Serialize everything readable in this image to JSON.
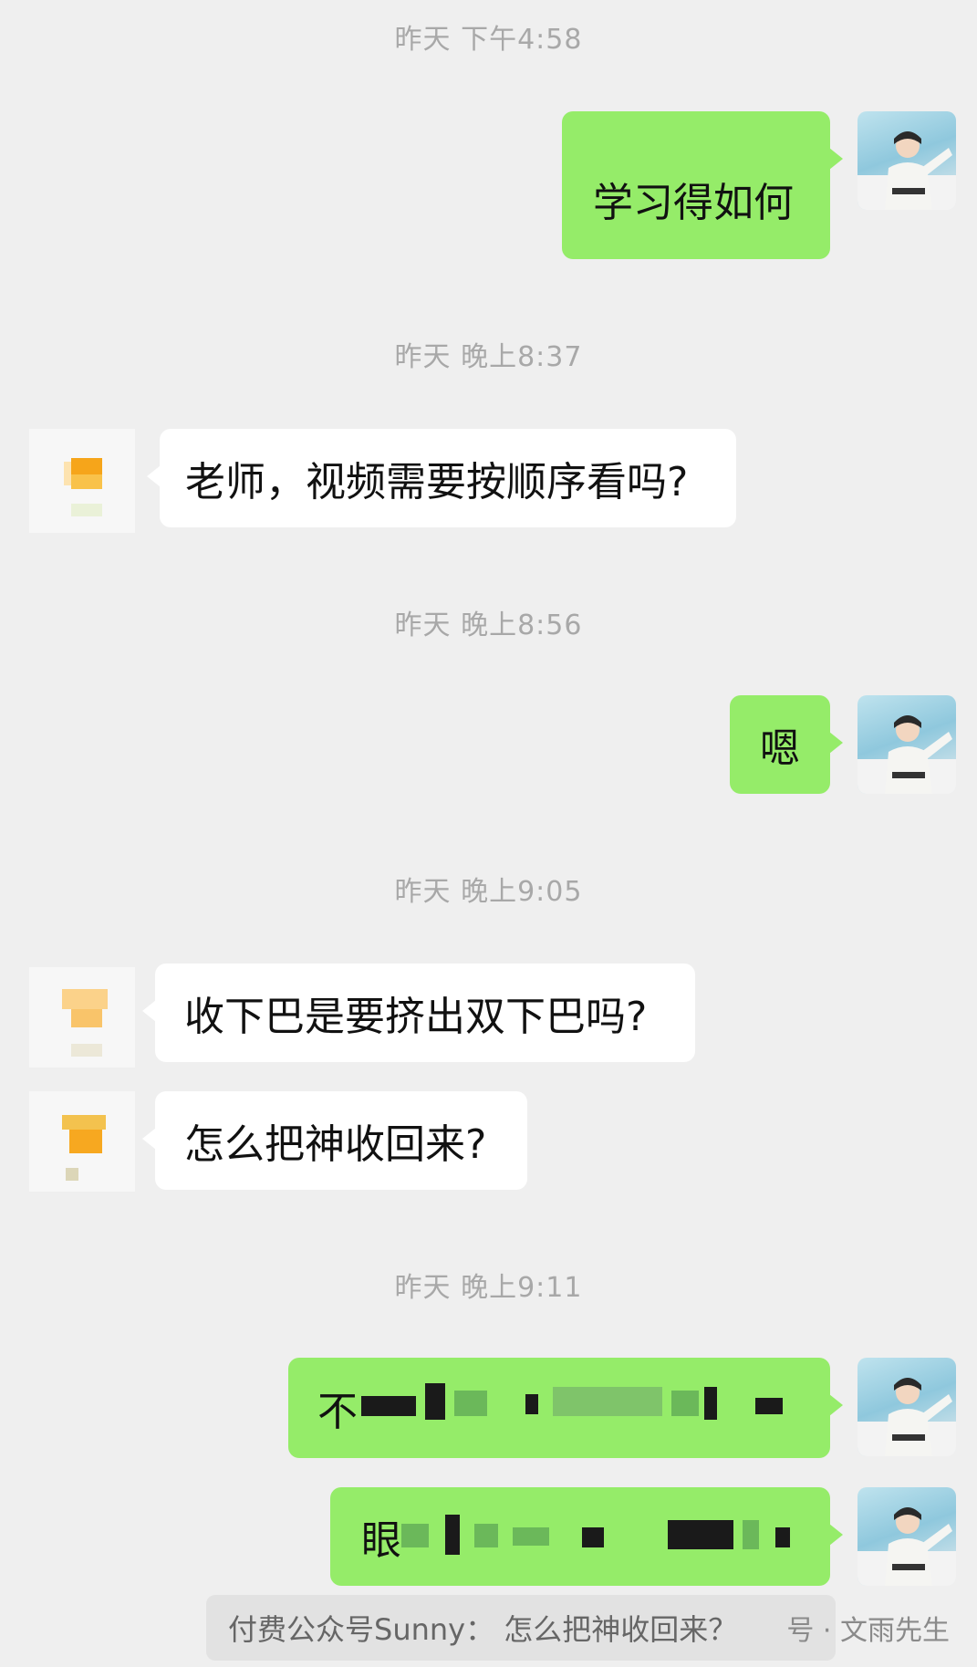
{
  "messages": [
    {
      "type": "time",
      "text": "昨天 下午4:58"
    },
    {
      "type": "sent",
      "text": "学习得如何"
    },
    {
      "type": "time",
      "text": "昨天 晚上8:37"
    },
    {
      "type": "received",
      "text": "老师，视频需要按顺序看吗?"
    },
    {
      "type": "time",
      "text": "昨天 晚上8:56"
    },
    {
      "type": "sent",
      "text": "嗯"
    },
    {
      "type": "time",
      "text": "昨天 晚上9:05"
    },
    {
      "type": "received",
      "text": "收下巴是要挤出双下巴吗?"
    },
    {
      "type": "received",
      "text": "怎么把神收回来?"
    },
    {
      "type": "time",
      "text": "昨天 晚上9:11"
    },
    {
      "type": "sent",
      "text": "不",
      "redacted": true
    },
    {
      "type": "sent",
      "text": "眼",
      "redacted": true
    }
  ],
  "footer": {
    "caption": "付费公众号Sunny： 怎么把神收回来？",
    "attribution": "号 · 文雨先生"
  },
  "colors": {
    "background": "#efefef",
    "sent_bubble": "#95ec69",
    "received_bubble": "#ffffff",
    "timestamp": "#a8a8a8"
  },
  "icons": {
    "my_avatar": "user-avatar-icon",
    "other_avatar": "contact-avatar-icon"
  }
}
